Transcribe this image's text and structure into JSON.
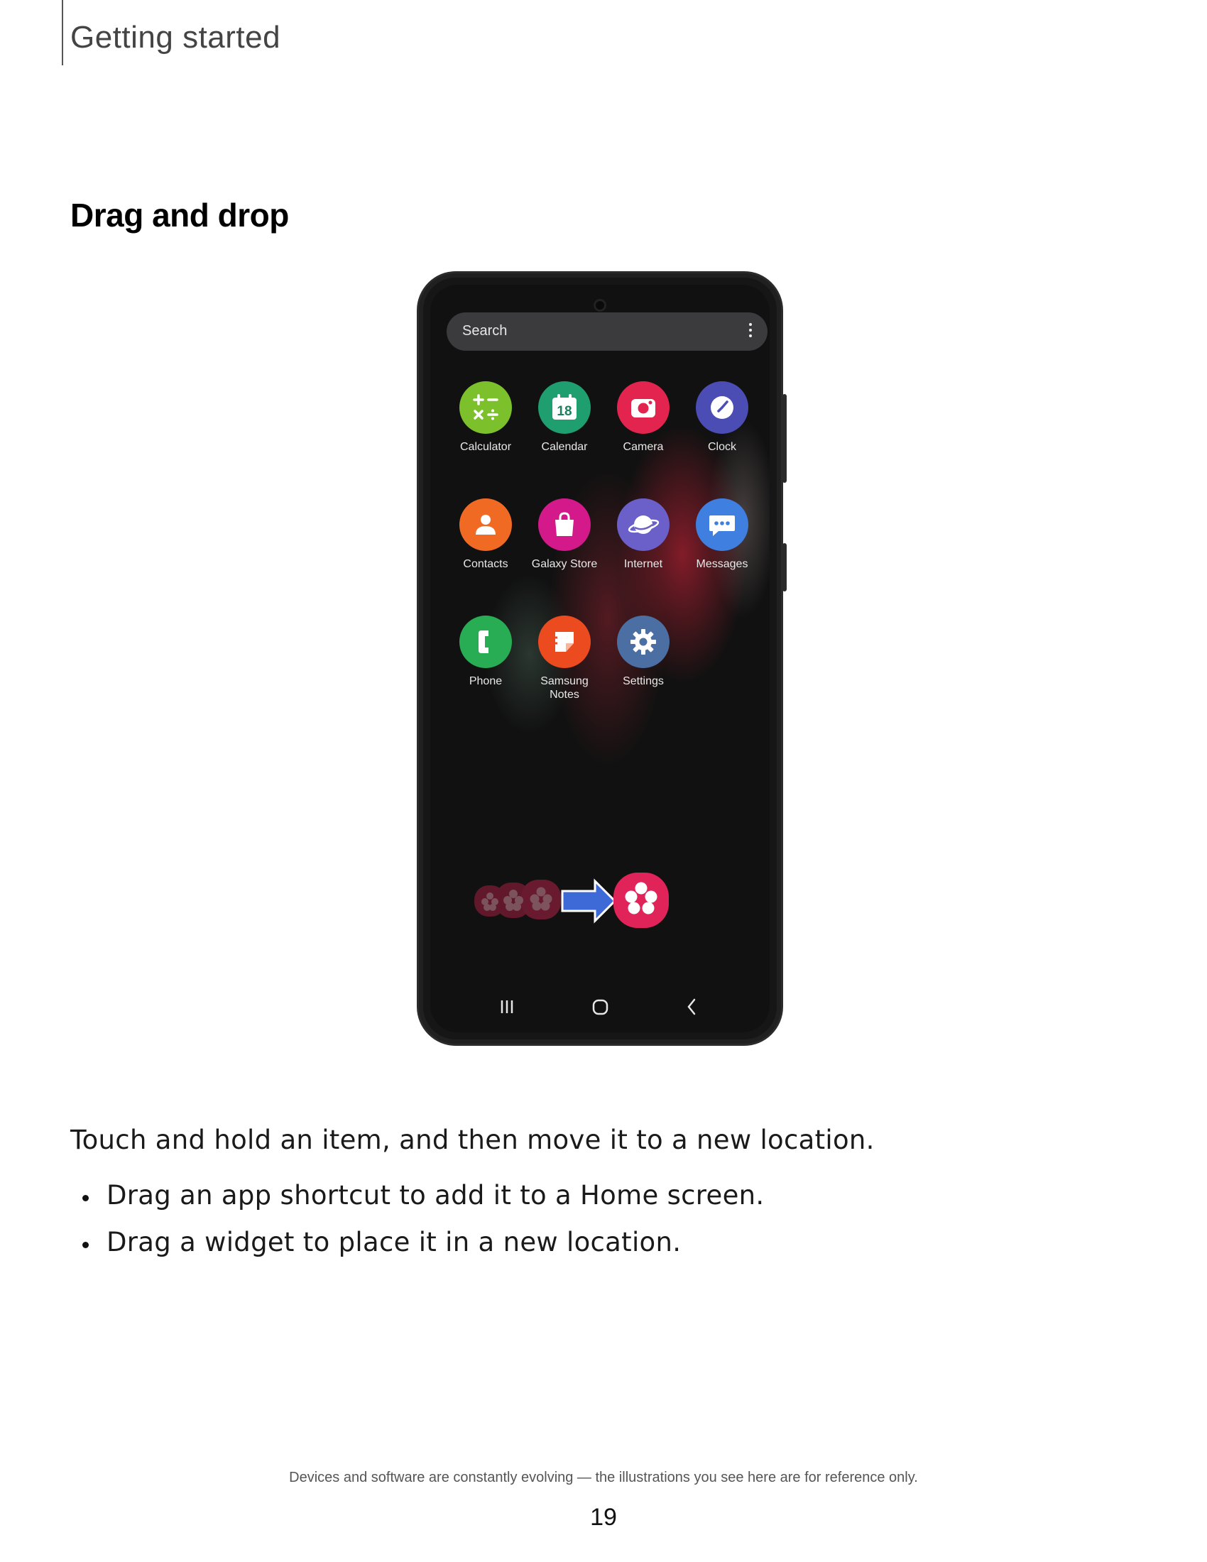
{
  "header": {
    "section": "Getting started"
  },
  "title": "Drag and drop",
  "phone": {
    "search_placeholder": "Search",
    "apps": [
      {
        "label": "Calculator",
        "icon": "calculator-icon",
        "color": "#7cc12b"
      },
      {
        "label": "Calendar",
        "icon": "calendar-icon",
        "color": "#1f9e6f",
        "date": "18"
      },
      {
        "label": "Camera",
        "icon": "camera-icon",
        "color": "#e3244f"
      },
      {
        "label": "Clock",
        "icon": "clock-icon",
        "color": "#4b4db5"
      },
      {
        "label": "Contacts",
        "icon": "contacts-icon",
        "color": "#f16a24"
      },
      {
        "label": "Galaxy Store",
        "icon": "shopping-bag-icon",
        "color": "#d4198b"
      },
      {
        "label": "Internet",
        "icon": "internet-icon",
        "color": "#6b5fc9"
      },
      {
        "label": "Messages",
        "icon": "messages-icon",
        "color": "#3f7fe0"
      },
      {
        "label": "Phone",
        "icon": "phone-icon",
        "color": "#29ad54"
      },
      {
        "label": "Samsung\nNotes",
        "icon": "notes-icon",
        "color": "#ec4a1f"
      },
      {
        "label": "Settings",
        "icon": "gear-icon",
        "color": "#4b6fa3"
      }
    ],
    "drag_icon_color": "#e0245a",
    "arrow_color": "#3d6ad6"
  },
  "body": {
    "intro": "Touch and hold an item, and then move it to a new location.",
    "bullets": [
      "Drag an app shortcut to add it to a Home screen.",
      "Drag a widget to place it in a new location."
    ]
  },
  "footer": {
    "note": "Devices and software are constantly evolving — the illustrations you see here are for reference only.",
    "page_number": "19"
  }
}
